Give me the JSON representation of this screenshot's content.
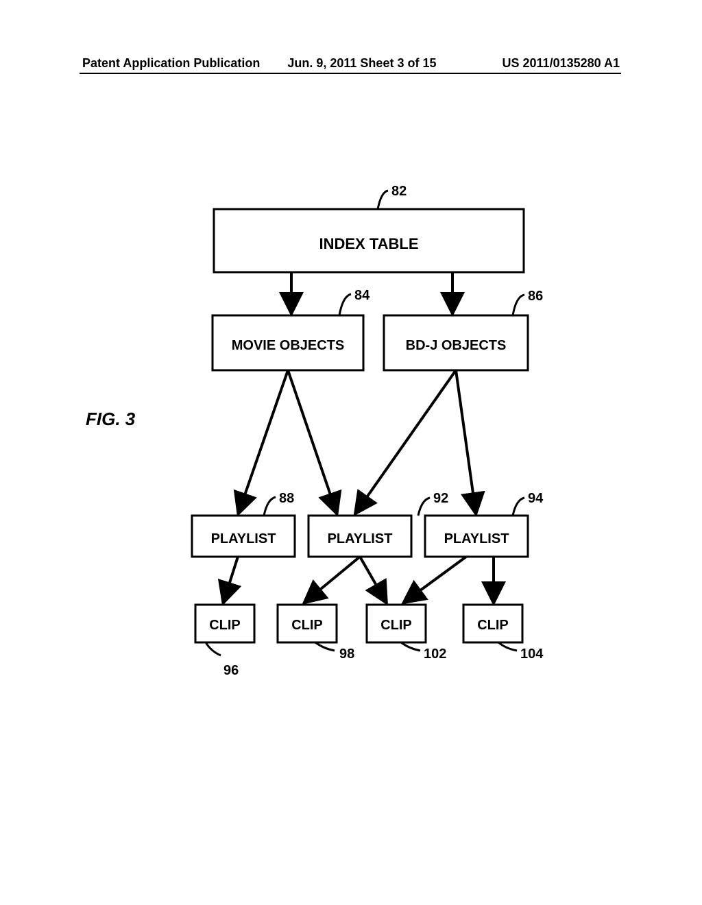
{
  "header": {
    "left": "Patent Application Publication",
    "center": "Jun. 9, 2011  Sheet 3 of 15",
    "right": "US 2011/0135280 A1"
  },
  "figure": {
    "label": "FIG. 3",
    "nodes": {
      "index_table": {
        "label": "INDEX TABLE",
        "ref": "82"
      },
      "movie_objects": {
        "label": "MOVIE OBJECTS",
        "ref": "84"
      },
      "bdj_objects": {
        "label": "BD-J OBJECTS",
        "ref": "86"
      },
      "playlist_1": {
        "label": "PLAYLIST",
        "ref": "88"
      },
      "playlist_2": {
        "label": "PLAYLIST",
        "ref": "92"
      },
      "playlist_3": {
        "label": "PLAYLIST",
        "ref": "94"
      },
      "clip_1": {
        "label": "CLIP",
        "ref": "96"
      },
      "clip_2": {
        "label": "CLIP",
        "ref": "98"
      },
      "clip_3": {
        "label": "CLIP",
        "ref": "102"
      },
      "clip_4": {
        "label": "CLIP",
        "ref": "104"
      }
    }
  }
}
